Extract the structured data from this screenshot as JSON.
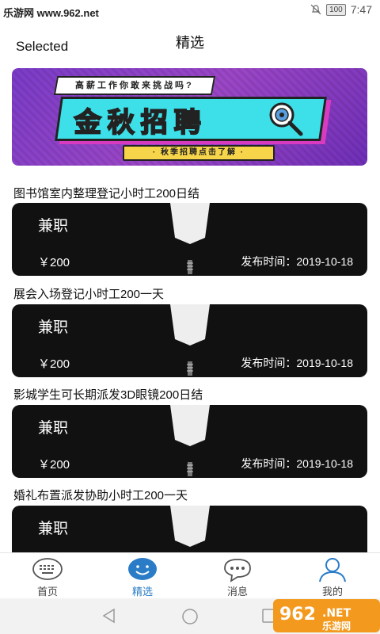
{
  "status_bar": {
    "site": "乐游网 www.962.net",
    "battery": "100",
    "time": "7:47"
  },
  "header": {
    "selected_label": "Selected",
    "title": "精选"
  },
  "banner": {
    "top_text": "高薪工作你敢来挑战吗?",
    "main_text": "金秋招聘",
    "bottom_text": "· 秋季招聘点击了解 ·"
  },
  "jobs": [
    {
      "title": "图书馆室内整理登记小时工200日结",
      "type": "兼职",
      "price": "￥200",
      "date": "发布时间：2019-10-18"
    },
    {
      "title": "展会入场登记小时工200一天",
      "type": "兼职",
      "price": "￥200",
      "date": "发布时间：2019-10-18"
    },
    {
      "title": "影城学生可长期派发3D眼镜200日结",
      "type": "兼职",
      "price": "￥200",
      "date": "发布时间：2019-10-18"
    },
    {
      "title": "婚礼布置派发协助小时工200一天",
      "type": "兼职",
      "price": "",
      "date": ""
    }
  ],
  "tabs": [
    {
      "label": "首页",
      "icon": "keyboard-icon"
    },
    {
      "label": "精选",
      "icon": "smile-icon"
    },
    {
      "label": "消息",
      "icon": "chat-icon"
    },
    {
      "label": "我的",
      "icon": "user-icon"
    }
  ],
  "watermark": "962.NET 乐游网",
  "colors": {
    "accent": "#2a7cc7",
    "card": "#111111",
    "banner_purple": "#8a3fc6",
    "banner_cyan": "#3de0e8",
    "banner_yellow": "#f7d54a"
  }
}
